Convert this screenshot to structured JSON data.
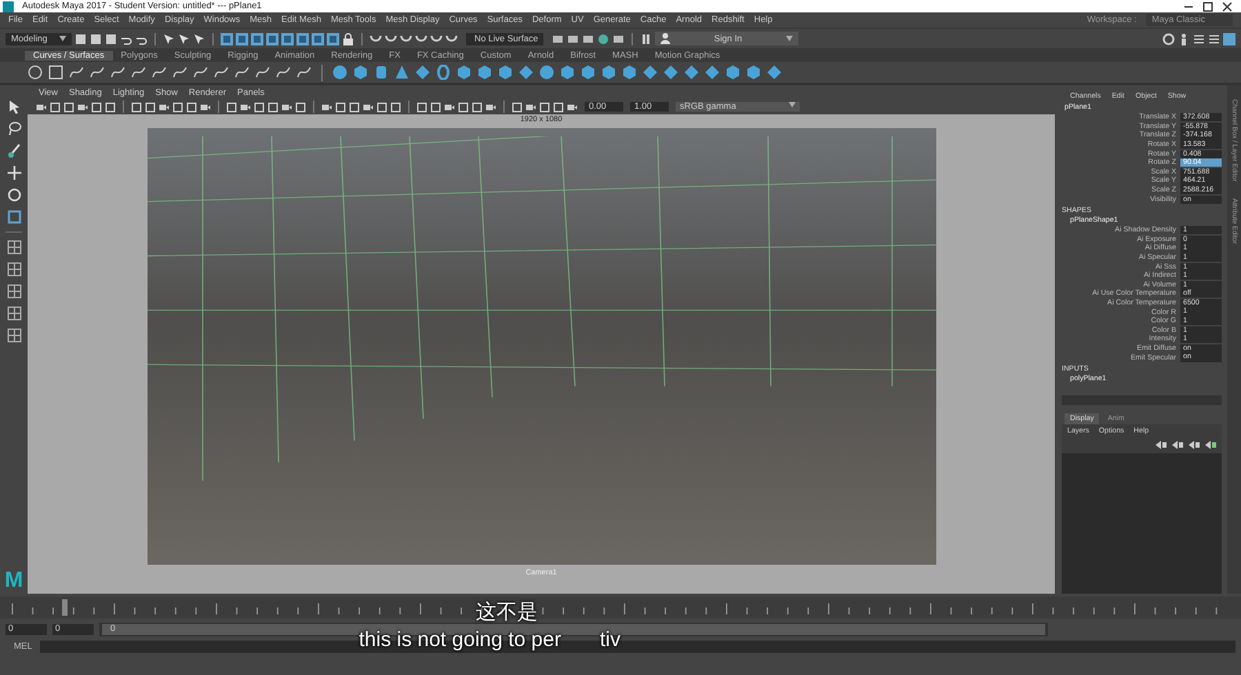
{
  "window": {
    "title": "Autodesk Maya 2017 - Student Version: untitled*   ---   pPlane1"
  },
  "menu_bar": {
    "items": [
      "File",
      "Edit",
      "Create",
      "Select",
      "Modify",
      "Display",
      "Windows",
      "Mesh",
      "Edit Mesh",
      "Mesh Tools",
      "Mesh Display",
      "Curves",
      "Surfaces",
      "Deform",
      "UV",
      "Generate",
      "Cache",
      "Arnold",
      "Redshift",
      "Help"
    ],
    "workspace_label": "Workspace :",
    "workspace": "Maya Classic"
  },
  "status_line": {
    "mode": "Modeling",
    "live_surface": "No Live Surface",
    "sign_in": "Sign In"
  },
  "shelf": {
    "tabs": [
      {
        "label": "Curves / Surfaces",
        "selected": true
      },
      {
        "label": "Polygons",
        "selected": false
      },
      {
        "label": "Sculpting",
        "selected": false
      },
      {
        "label": "Rigging",
        "selected": false
      },
      {
        "label": "Animation",
        "selected": false
      },
      {
        "label": "Rendering",
        "selected": false
      },
      {
        "label": "FX",
        "selected": false
      },
      {
        "label": "FX Caching",
        "selected": false
      },
      {
        "label": "Custom",
        "selected": false
      },
      {
        "label": "Arnold",
        "selected": false
      },
      {
        "label": "Bifrost",
        "selected": false
      },
      {
        "label": "MASH",
        "selected": false
      },
      {
        "label": "Motion Graphics",
        "selected": false
      }
    ]
  },
  "viewport": {
    "menu": [
      "View",
      "Shading",
      "Lighting",
      "Show",
      "Renderer",
      "Panels"
    ],
    "exposure": "0.00",
    "gamma": "1.00",
    "color_space": "sRGB gamma",
    "resolution": "1920 x 1080",
    "camera": "Camera1"
  },
  "channel_box": {
    "tabs": [
      "Channels",
      "Edit",
      "Object",
      "Show"
    ],
    "object": "pPlane1",
    "channels": [
      {
        "name": "Translate X",
        "value": "372.608",
        "selected": false
      },
      {
        "name": "Translate Y",
        "value": "-55.878",
        "selected": false
      },
      {
        "name": "Translate Z",
        "value": "-374.168",
        "selected": false
      },
      {
        "name": "Rotate X",
        "value": "13.583",
        "selected": false
      },
      {
        "name": "Rotate Y",
        "value": "0.408",
        "selected": false
      },
      {
        "name": "Rotate Z",
        "value": "90.04",
        "selected": true
      },
      {
        "name": "Scale X",
        "value": "751.688",
        "selected": false
      },
      {
        "name": "Scale Y",
        "value": "464.21",
        "selected": false
      },
      {
        "name": "Scale Z",
        "value": "2588.216",
        "selected": false
      },
      {
        "name": "Visibility",
        "value": "on",
        "selected": false
      }
    ],
    "shapes_header": "SHAPES",
    "shape": "pPlaneShape1",
    "shape_channels": [
      {
        "name": "Ai Shadow Density",
        "value": "1"
      },
      {
        "name": "Ai Exposure",
        "value": "0"
      },
      {
        "name": "Ai Diffuse",
        "value": "1"
      },
      {
        "name": "Ai Specular",
        "value": "1"
      },
      {
        "name": "Ai Sss",
        "value": "1"
      },
      {
        "name": "Ai Indirect",
        "value": "1"
      },
      {
        "name": "Ai Volume",
        "value": "1"
      },
      {
        "name": "Ai Use Color Temperature",
        "value": "off"
      },
      {
        "name": "Ai Color Temperature",
        "value": "6500"
      },
      {
        "name": "Color R",
        "value": "1"
      },
      {
        "name": "Color G",
        "value": "1"
      },
      {
        "name": "Color B",
        "value": "1"
      },
      {
        "name": "Intensity",
        "value": "1"
      },
      {
        "name": "Emit Diffuse",
        "value": "on"
      },
      {
        "name": "Emit Specular",
        "value": "on"
      }
    ],
    "inputs_header": "INPUTS",
    "input": "polyPlane1"
  },
  "layer_editor": {
    "tabs": [
      {
        "label": "Display",
        "selected": true
      },
      {
        "label": "Anim",
        "selected": false
      }
    ],
    "menu": [
      "Layers",
      "Options",
      "Help"
    ]
  },
  "side_tabs": [
    "Channel Box / Layer Editor",
    "Attribute Editor"
  ],
  "logo": "M",
  "timeline": {
    "level": 0.05
  },
  "range": {
    "start": "0",
    "playback_start": "0",
    "slider": "0",
    "level": 1
  },
  "command_line": {
    "label": "MEL"
  },
  "subtitles": {
    "chinese": "这不是",
    "english": "this is not going to per",
    "english_tail": "tiv"
  }
}
